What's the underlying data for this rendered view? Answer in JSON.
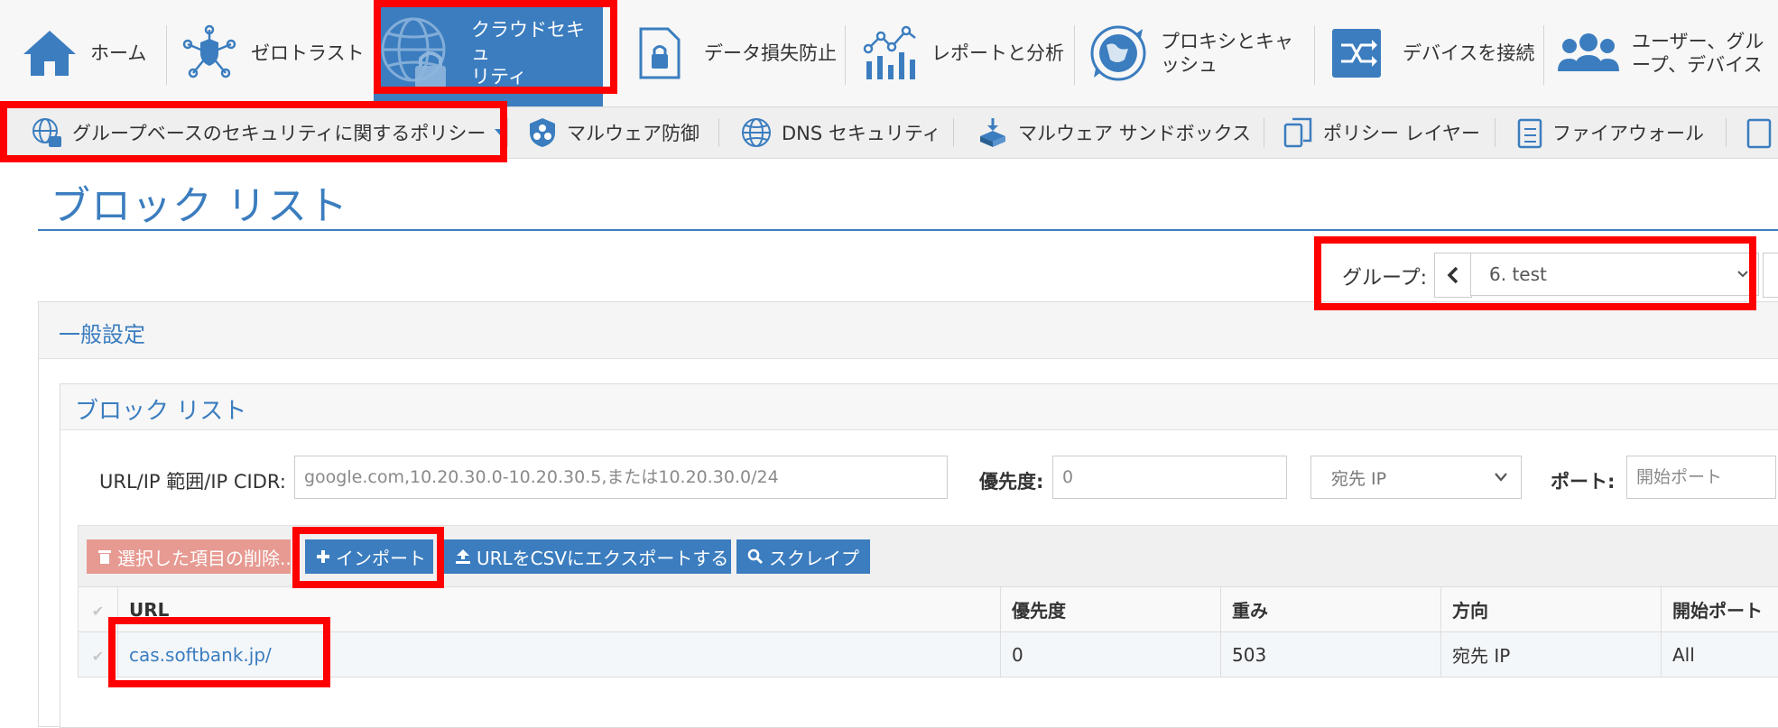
{
  "topnav": {
    "items": [
      {
        "label": "ホーム",
        "icon": "home-icon"
      },
      {
        "label": "ゼロトラスト",
        "icon": "zero-trust-shield-icon"
      },
      {
        "label": "クラウドセキュ\nリティ",
        "icon": "cloud-security-globe-lock-icon",
        "active": true
      },
      {
        "label": "データ損失防止",
        "icon": "data-loss-lock-icon"
      },
      {
        "label": "レポートと分析",
        "icon": "report-chart-icon"
      },
      {
        "label": "プロキシとキャ\nッシュ",
        "icon": "proxy-globe-icon"
      },
      {
        "label": "デバイスを接続",
        "icon": "device-connect-icon"
      },
      {
        "label": "ユーザー、グル\nープ、デバイス",
        "icon": "users-group-icon"
      }
    ]
  },
  "subnav": {
    "items": [
      {
        "label": "グループベースのセキュリティに関するポリシー",
        "icon": "globe-policy-icon",
        "dropdown": true
      },
      {
        "label": "マルウェア防御",
        "icon": "biohazard-shield-icon"
      },
      {
        "label": "DNS セキュリティ",
        "icon": "dns-globe-icon"
      },
      {
        "label": "マルウェア サンドボックス",
        "icon": "sandbox-icon"
      },
      {
        "label": "ポリシー レイヤー",
        "icon": "policy-layer-icon"
      },
      {
        "label": "ファイアウォール",
        "icon": "firewall-checklist-icon"
      }
    ]
  },
  "page": {
    "title": "ブロック リスト"
  },
  "group": {
    "label": "グループ:",
    "selected": "6. test"
  },
  "general": {
    "title": "一般設定"
  },
  "blocklist": {
    "title": "ブロック リスト",
    "form": {
      "url_label": "URL/IP 範囲/IP CIDR:",
      "url_placeholder": "google.com,10.20.30.0-10.20.30.5,または10.20.30.0/24",
      "priority_label": "優先度:",
      "priority_placeholder": "0",
      "direction_selected": "宛先 IP",
      "port_label": "ポート:",
      "port_placeholder": "開始ポート"
    },
    "toolbar": {
      "delete_label": "選択した項目の削除...",
      "import_label": "インポート",
      "export_label": "URLをCSVにエクスポートする",
      "scrape_label": "スクレイプ"
    },
    "table": {
      "headers": [
        "URL",
        "優先度",
        "重み",
        "方向",
        "開始ポート"
      ],
      "rows": [
        [
          "cas.softbank.jp/",
          "0",
          "503",
          "宛先 IP",
          "All"
        ]
      ]
    }
  },
  "colors": {
    "accent": "#3b7dbf",
    "highlight": "#ff0000",
    "danger": "#e79a92"
  }
}
